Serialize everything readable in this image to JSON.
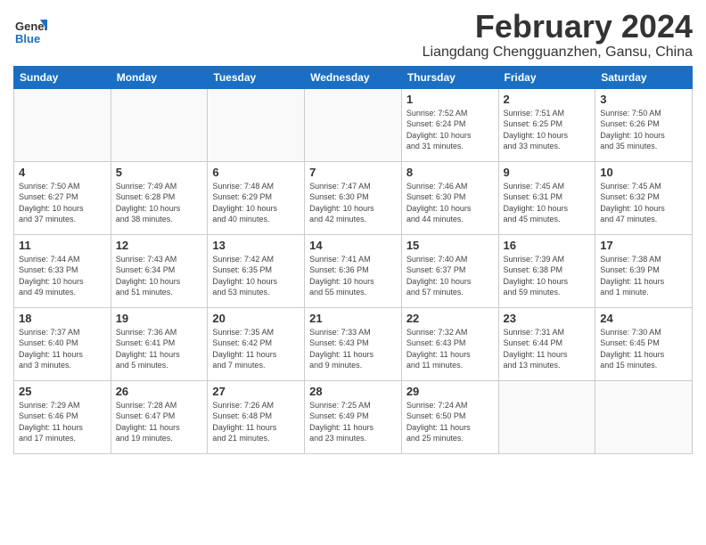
{
  "header": {
    "logo_line1": "General",
    "logo_line2": "Blue",
    "month_year": "February 2024",
    "location": "Liangdang Chengguanzhen, Gansu, China"
  },
  "weekdays": [
    "Sunday",
    "Monday",
    "Tuesday",
    "Wednesday",
    "Thursday",
    "Friday",
    "Saturday"
  ],
  "weeks": [
    [
      {
        "day": "",
        "info": ""
      },
      {
        "day": "",
        "info": ""
      },
      {
        "day": "",
        "info": ""
      },
      {
        "day": "",
        "info": ""
      },
      {
        "day": "1",
        "info": "Sunrise: 7:52 AM\nSunset: 6:24 PM\nDaylight: 10 hours\nand 31 minutes."
      },
      {
        "day": "2",
        "info": "Sunrise: 7:51 AM\nSunset: 6:25 PM\nDaylight: 10 hours\nand 33 minutes."
      },
      {
        "day": "3",
        "info": "Sunrise: 7:50 AM\nSunset: 6:26 PM\nDaylight: 10 hours\nand 35 minutes."
      }
    ],
    [
      {
        "day": "4",
        "info": "Sunrise: 7:50 AM\nSunset: 6:27 PM\nDaylight: 10 hours\nand 37 minutes."
      },
      {
        "day": "5",
        "info": "Sunrise: 7:49 AM\nSunset: 6:28 PM\nDaylight: 10 hours\nand 38 minutes."
      },
      {
        "day": "6",
        "info": "Sunrise: 7:48 AM\nSunset: 6:29 PM\nDaylight: 10 hours\nand 40 minutes."
      },
      {
        "day": "7",
        "info": "Sunrise: 7:47 AM\nSunset: 6:30 PM\nDaylight: 10 hours\nand 42 minutes."
      },
      {
        "day": "8",
        "info": "Sunrise: 7:46 AM\nSunset: 6:30 PM\nDaylight: 10 hours\nand 44 minutes."
      },
      {
        "day": "9",
        "info": "Sunrise: 7:45 AM\nSunset: 6:31 PM\nDaylight: 10 hours\nand 45 minutes."
      },
      {
        "day": "10",
        "info": "Sunrise: 7:45 AM\nSunset: 6:32 PM\nDaylight: 10 hours\nand 47 minutes."
      }
    ],
    [
      {
        "day": "11",
        "info": "Sunrise: 7:44 AM\nSunset: 6:33 PM\nDaylight: 10 hours\nand 49 minutes."
      },
      {
        "day": "12",
        "info": "Sunrise: 7:43 AM\nSunset: 6:34 PM\nDaylight: 10 hours\nand 51 minutes."
      },
      {
        "day": "13",
        "info": "Sunrise: 7:42 AM\nSunset: 6:35 PM\nDaylight: 10 hours\nand 53 minutes."
      },
      {
        "day": "14",
        "info": "Sunrise: 7:41 AM\nSunset: 6:36 PM\nDaylight: 10 hours\nand 55 minutes."
      },
      {
        "day": "15",
        "info": "Sunrise: 7:40 AM\nSunset: 6:37 PM\nDaylight: 10 hours\nand 57 minutes."
      },
      {
        "day": "16",
        "info": "Sunrise: 7:39 AM\nSunset: 6:38 PM\nDaylight: 10 hours\nand 59 minutes."
      },
      {
        "day": "17",
        "info": "Sunrise: 7:38 AM\nSunset: 6:39 PM\nDaylight: 11 hours\nand 1 minute."
      }
    ],
    [
      {
        "day": "18",
        "info": "Sunrise: 7:37 AM\nSunset: 6:40 PM\nDaylight: 11 hours\nand 3 minutes."
      },
      {
        "day": "19",
        "info": "Sunrise: 7:36 AM\nSunset: 6:41 PM\nDaylight: 11 hours\nand 5 minutes."
      },
      {
        "day": "20",
        "info": "Sunrise: 7:35 AM\nSunset: 6:42 PM\nDaylight: 11 hours\nand 7 minutes."
      },
      {
        "day": "21",
        "info": "Sunrise: 7:33 AM\nSunset: 6:43 PM\nDaylight: 11 hours\nand 9 minutes."
      },
      {
        "day": "22",
        "info": "Sunrise: 7:32 AM\nSunset: 6:43 PM\nDaylight: 11 hours\nand 11 minutes."
      },
      {
        "day": "23",
        "info": "Sunrise: 7:31 AM\nSunset: 6:44 PM\nDaylight: 11 hours\nand 13 minutes."
      },
      {
        "day": "24",
        "info": "Sunrise: 7:30 AM\nSunset: 6:45 PM\nDaylight: 11 hours\nand 15 minutes."
      }
    ],
    [
      {
        "day": "25",
        "info": "Sunrise: 7:29 AM\nSunset: 6:46 PM\nDaylight: 11 hours\nand 17 minutes."
      },
      {
        "day": "26",
        "info": "Sunrise: 7:28 AM\nSunset: 6:47 PM\nDaylight: 11 hours\nand 19 minutes."
      },
      {
        "day": "27",
        "info": "Sunrise: 7:26 AM\nSunset: 6:48 PM\nDaylight: 11 hours\nand 21 minutes."
      },
      {
        "day": "28",
        "info": "Sunrise: 7:25 AM\nSunset: 6:49 PM\nDaylight: 11 hours\nand 23 minutes."
      },
      {
        "day": "29",
        "info": "Sunrise: 7:24 AM\nSunset: 6:50 PM\nDaylight: 11 hours\nand 25 minutes."
      },
      {
        "day": "",
        "info": ""
      },
      {
        "day": "",
        "info": ""
      }
    ]
  ]
}
